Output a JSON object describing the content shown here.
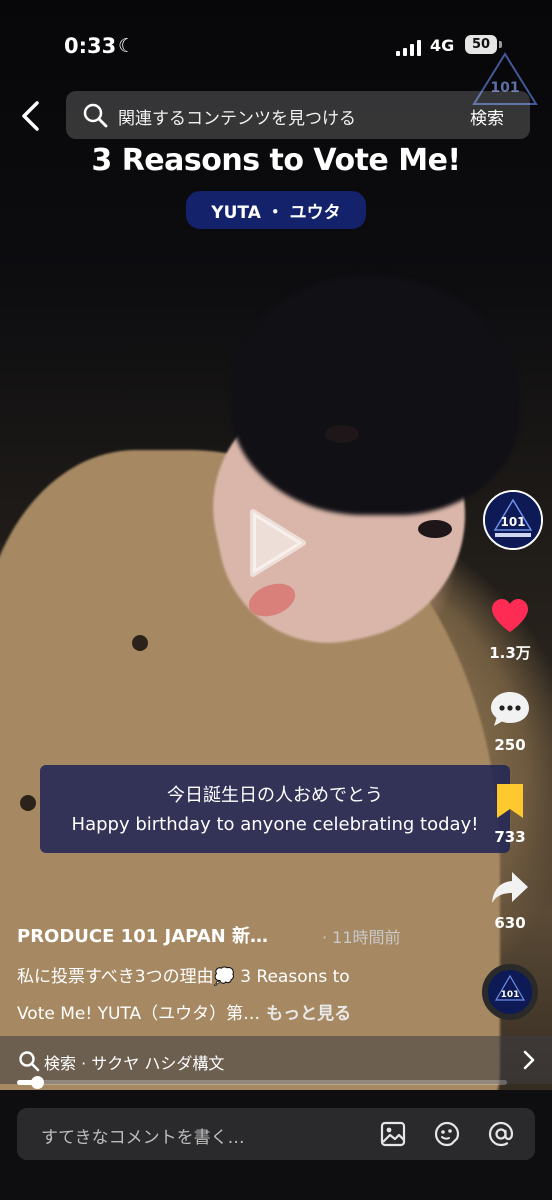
{
  "status_bar": {
    "time": "0:33",
    "network": "4G",
    "battery": "50"
  },
  "search": {
    "placeholder": "関連するコンテンツを見つける",
    "button": "検索"
  },
  "video": {
    "title": "3 Reasons to Vote Me!",
    "tag": "YUTA ・ ユウタ",
    "subtitle_jp": "今日誕生日の人おめでとう",
    "subtitle_en": "Happy birthday to anyone celebrating today!",
    "progress": 0.04
  },
  "actions": {
    "likes": "1.3万",
    "comments": "250",
    "saves": "733",
    "shares": "630"
  },
  "post": {
    "author": "PRODUCE 101 JAPAN 新…",
    "posted": "· 11時間前",
    "caption_line1": "私に投票すべき3つの理由💭 3 Reasons to",
    "caption_line2": "Vote Me! YUTA（ユウタ）第…",
    "more": "もっと見る"
  },
  "related_search": {
    "label": "検索 · サクヤ ハシダ構文"
  },
  "comment_bar": {
    "placeholder": "すてきなコメントを書く…"
  },
  "colors": {
    "like": "#fe2c55",
    "save": "#fdc92f",
    "tag_bg": "#13226b"
  }
}
